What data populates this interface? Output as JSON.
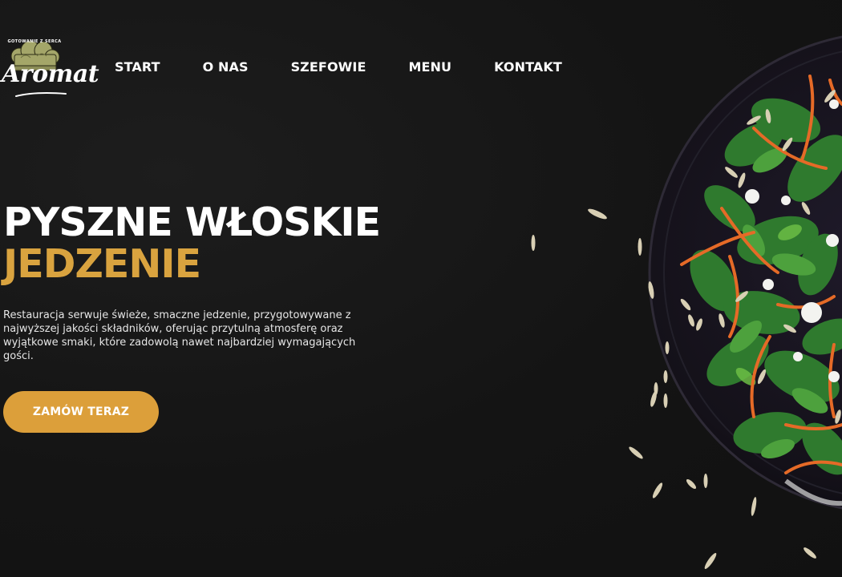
{
  "logo": {
    "tagline": "GOTOWANIE Z SERCA",
    "wordmark": "Aromat",
    "icon": "chef-hat-icon"
  },
  "nav": {
    "items": [
      {
        "label": "START"
      },
      {
        "label": "O NAS"
      },
      {
        "label": "SZEFOWIE"
      },
      {
        "label": "MENU"
      },
      {
        "label": "KONTAKT"
      }
    ]
  },
  "hero": {
    "title_line1": "PYSZNE WŁOSKIE",
    "title_line2": "JEDZENIE",
    "description": "Restauracja serwuje świeże, smaczne jedzenie, przygotowywane z najwyższej jakości składników, oferując przytulną atmosferę oraz wyjątkowe smaki, które zadowolą nawet najbardziej wymagających gości.",
    "cta_label": "ZAMÓW TERAZ"
  },
  "colors": {
    "background": "#131313",
    "accent": "#d9a33f",
    "button": "#dc9f3a",
    "text": "#ffffff"
  },
  "image": {
    "subject": "salad-plate-image"
  }
}
